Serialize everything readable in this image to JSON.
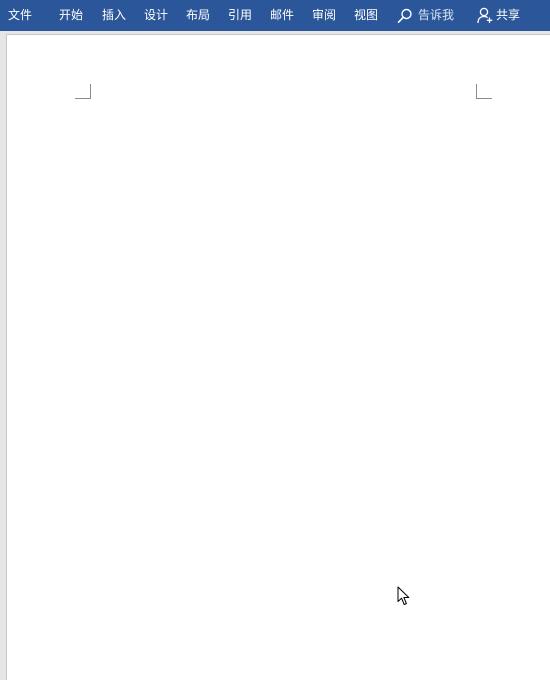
{
  "ribbon": {
    "tabs": {
      "file": "文件",
      "home": "开始",
      "insert": "插入",
      "design": "设计",
      "layout": "布局",
      "references": "引用",
      "mailings": "邮件",
      "review": "审阅",
      "view": "视图"
    },
    "tell_me": {
      "icon": "search-icon",
      "label": "告诉我"
    },
    "share": {
      "icon": "person-add-icon",
      "label": "共享"
    },
    "colors": {
      "ribbon_background": "#2b579a",
      "ribbon_text": "#ffffff"
    }
  },
  "document": {
    "page_color": "#ffffff",
    "canvas_color": "#e6e6e6"
  }
}
